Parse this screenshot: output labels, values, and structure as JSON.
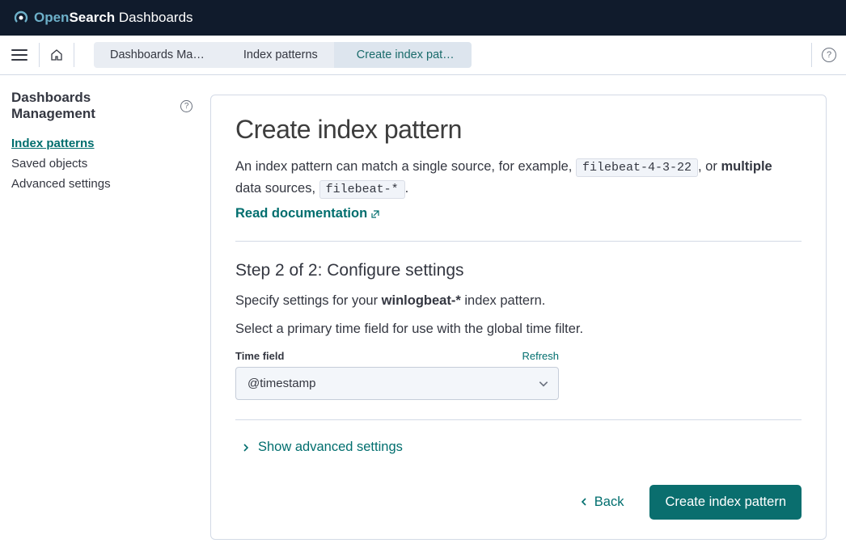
{
  "brand": {
    "open": "Open",
    "search": "Search",
    "dash": " Dashboards"
  },
  "breadcrumbs": [
    "Dashboards Ma…",
    "Index patterns",
    "Create index pattern"
  ],
  "sidebar": {
    "title": "Dashboards Management",
    "links": [
      "Index patterns",
      "Saved objects",
      "Advanced settings"
    ],
    "active_index": 0
  },
  "page": {
    "title": "Create index pattern",
    "desc_1": "An index pattern can match a single source, for example, ",
    "code_1": "filebeat-4-3-22",
    "desc_2": ", or ",
    "bold_multi": "multiple",
    "desc_3": " data sources, ",
    "code_2": "filebeat-*",
    "desc_4": ".",
    "doc_link": "Read documentation"
  },
  "step": {
    "title": "Step 2 of 2: Configure settings",
    "line1_a": "Specify settings for your ",
    "line1_bold": "winlogbeat-*",
    "line1_b": " index pattern.",
    "line2": "Select a primary time field for use with the global time filter."
  },
  "field": {
    "label": "Time field",
    "refresh": "Refresh",
    "value": "@timestamp"
  },
  "advanced": "Show advanced settings",
  "buttons": {
    "back": "Back",
    "create": "Create index pattern"
  }
}
